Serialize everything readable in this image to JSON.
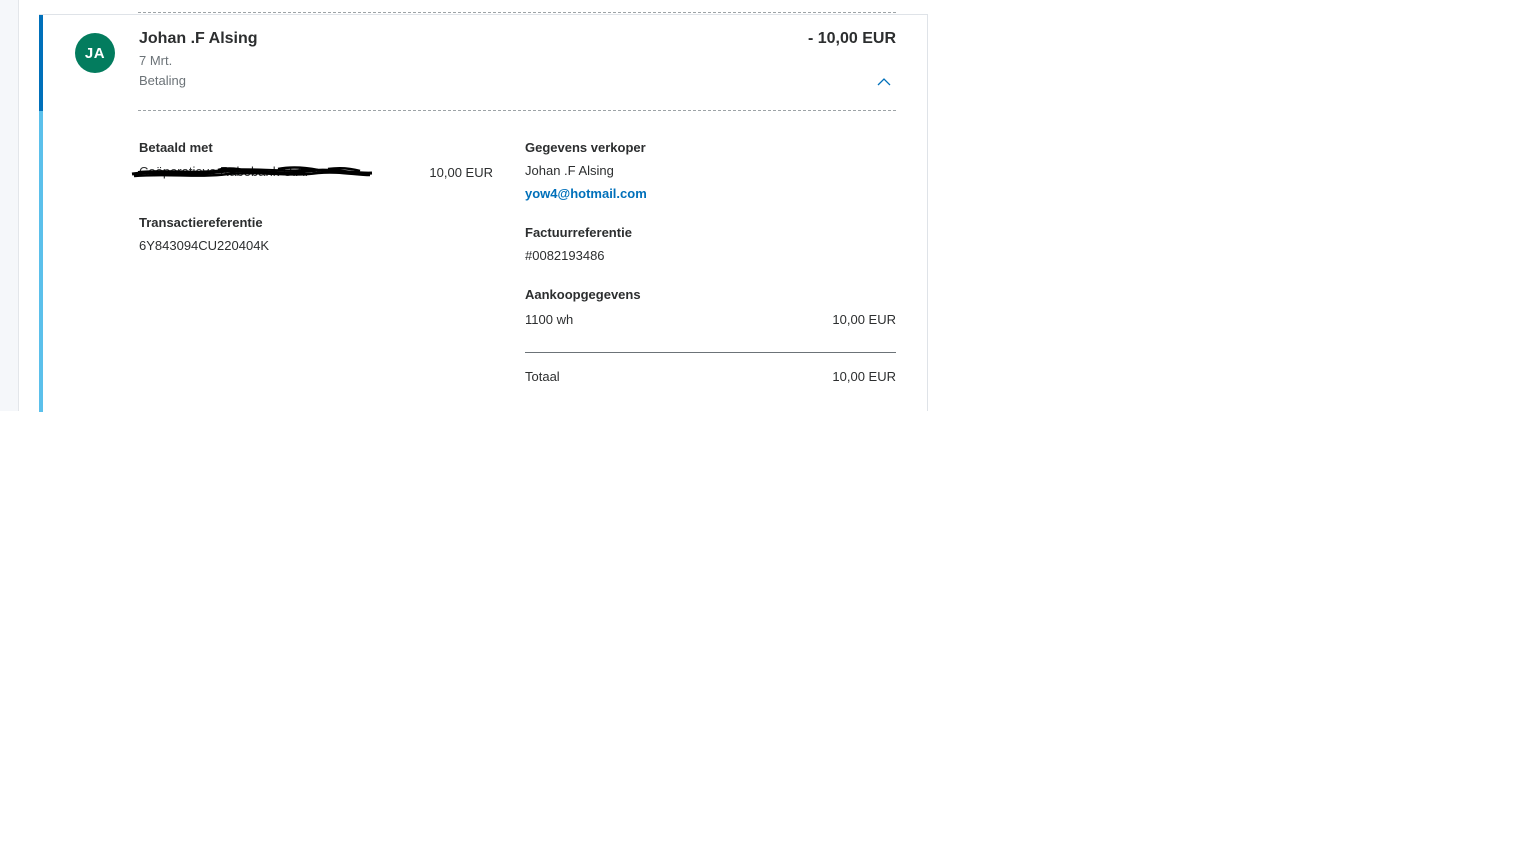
{
  "transaction": {
    "avatar_initials": "JA",
    "name": "Johan .F Alsing",
    "date": "7 Mrt.",
    "type": "Betaling",
    "amount": "- 10,00 EUR"
  },
  "details": {
    "paid_with_label": "Betaald met",
    "paid_with_source": "Coöperatieve Rabobank U.A. ••••",
    "paid_with_amount": "10,00 EUR",
    "transaction_ref_label": "Transactiereferentie",
    "transaction_ref": "6Y843094CU220404K",
    "seller_label": "Gegevens verkoper",
    "seller_name": "Johan .F Alsing",
    "seller_email": "yow4@hotmail.com",
    "invoice_ref_label": "Factuurreferentie",
    "invoice_ref": "#0082193486",
    "purchase_label": "Aankoopgegevens",
    "purchase_item": "1100 wh",
    "purchase_item_amount": "10,00 EUR",
    "total_label": "Totaal",
    "total_amount": "10,00 EUR"
  },
  "icons": {
    "collapse": "chevron-up-icon"
  },
  "colors": {
    "avatar_bg": "#037c5e",
    "accent_dark": "#0070ba",
    "accent_light": "#5bc0eb",
    "link": "#0070ba"
  }
}
